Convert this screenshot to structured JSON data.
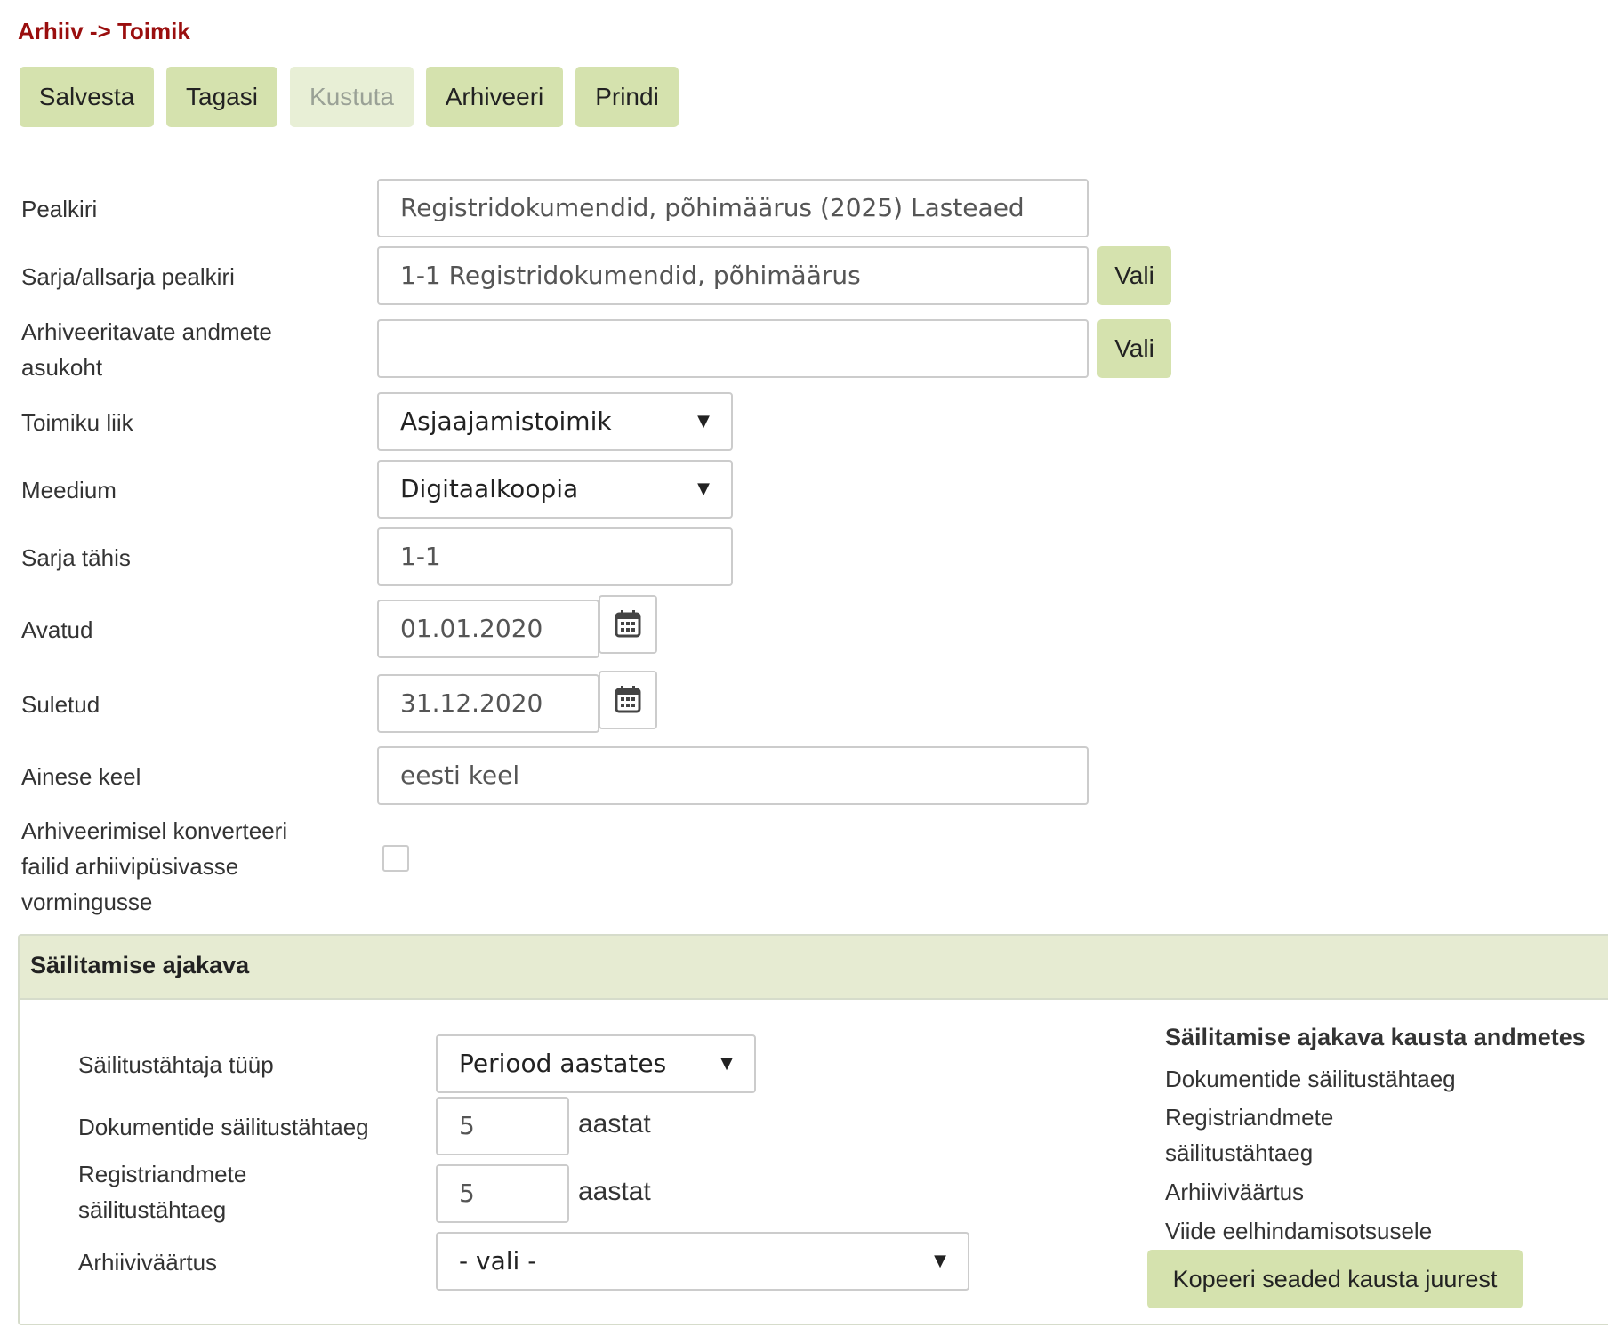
{
  "breadcrumb": "Arhiiv -> Toimik",
  "toolbar": {
    "save": "Salvesta",
    "back": "Tagasi",
    "delete": "Kustuta",
    "archive": "Arhiveeri",
    "print": "Prindi"
  },
  "form": {
    "title_label": "Pealkiri",
    "title_value": "Registridokumendid, põhimäärus (2025) Lasteaed",
    "series_label": "Sarja/allsarja pealkiri",
    "series_value": "1-1 Registridokumendid, põhimäärus",
    "choose_label": "Vali",
    "location_label_1": "Arhiveeritavate andmete",
    "location_label_2": "asukoht",
    "location_value": "",
    "type_label": "Toimiku liik",
    "type_value": "Asjaajamistoimik",
    "medium_label": "Meedium",
    "medium_value": "Digitaalkoopia",
    "series_code_label": "Sarja tähis",
    "series_code_value": "1-1",
    "opened_label": "Avatud",
    "opened_value": "01.01.2020",
    "closed_label": "Suletud",
    "closed_value": "31.12.2020",
    "language_label": "Ainese keel",
    "language_value": "eesti keel",
    "convert_label_1": "Arhiveerimisel konverteeri",
    "convert_label_2": "failid arhiivipüsivasse",
    "convert_label_3": "vormingusse",
    "convert_checked": false
  },
  "retention": {
    "title": "Säilitamise ajakava",
    "period_type_label": "Säilitustähtaja tüüp",
    "period_type_value": "Periood aastates",
    "doc_retention_label": "Dokumentide säilitustähtaeg",
    "doc_retention_value": "5",
    "reg_retention_label_1": "Registriandmete",
    "reg_retention_label_2": "säilitustähtaeg",
    "reg_retention_value": "5",
    "unit": "aastat",
    "archival_value_label": "Arhiiviväärtus",
    "archival_value_value": "- vali -",
    "folder_title": "Säilitamise ajakava kausta andmetes",
    "folder_doc": "Dokumentide säilitustähtaeg",
    "folder_reg_1": "Registriandmete",
    "folder_reg_2": "säilitustähtaeg",
    "folder_archival": "Arhiiviväärtus",
    "folder_reference": "Viide eelhindamisotsusele",
    "copy_button": "Kopeeri seaded kausta juurest"
  },
  "colors": {
    "breadcrumb": "#9a0e0e",
    "button": "#d5e2ae",
    "button_disabled": "#e8efd6",
    "panel_header": "#e6ebd2"
  }
}
